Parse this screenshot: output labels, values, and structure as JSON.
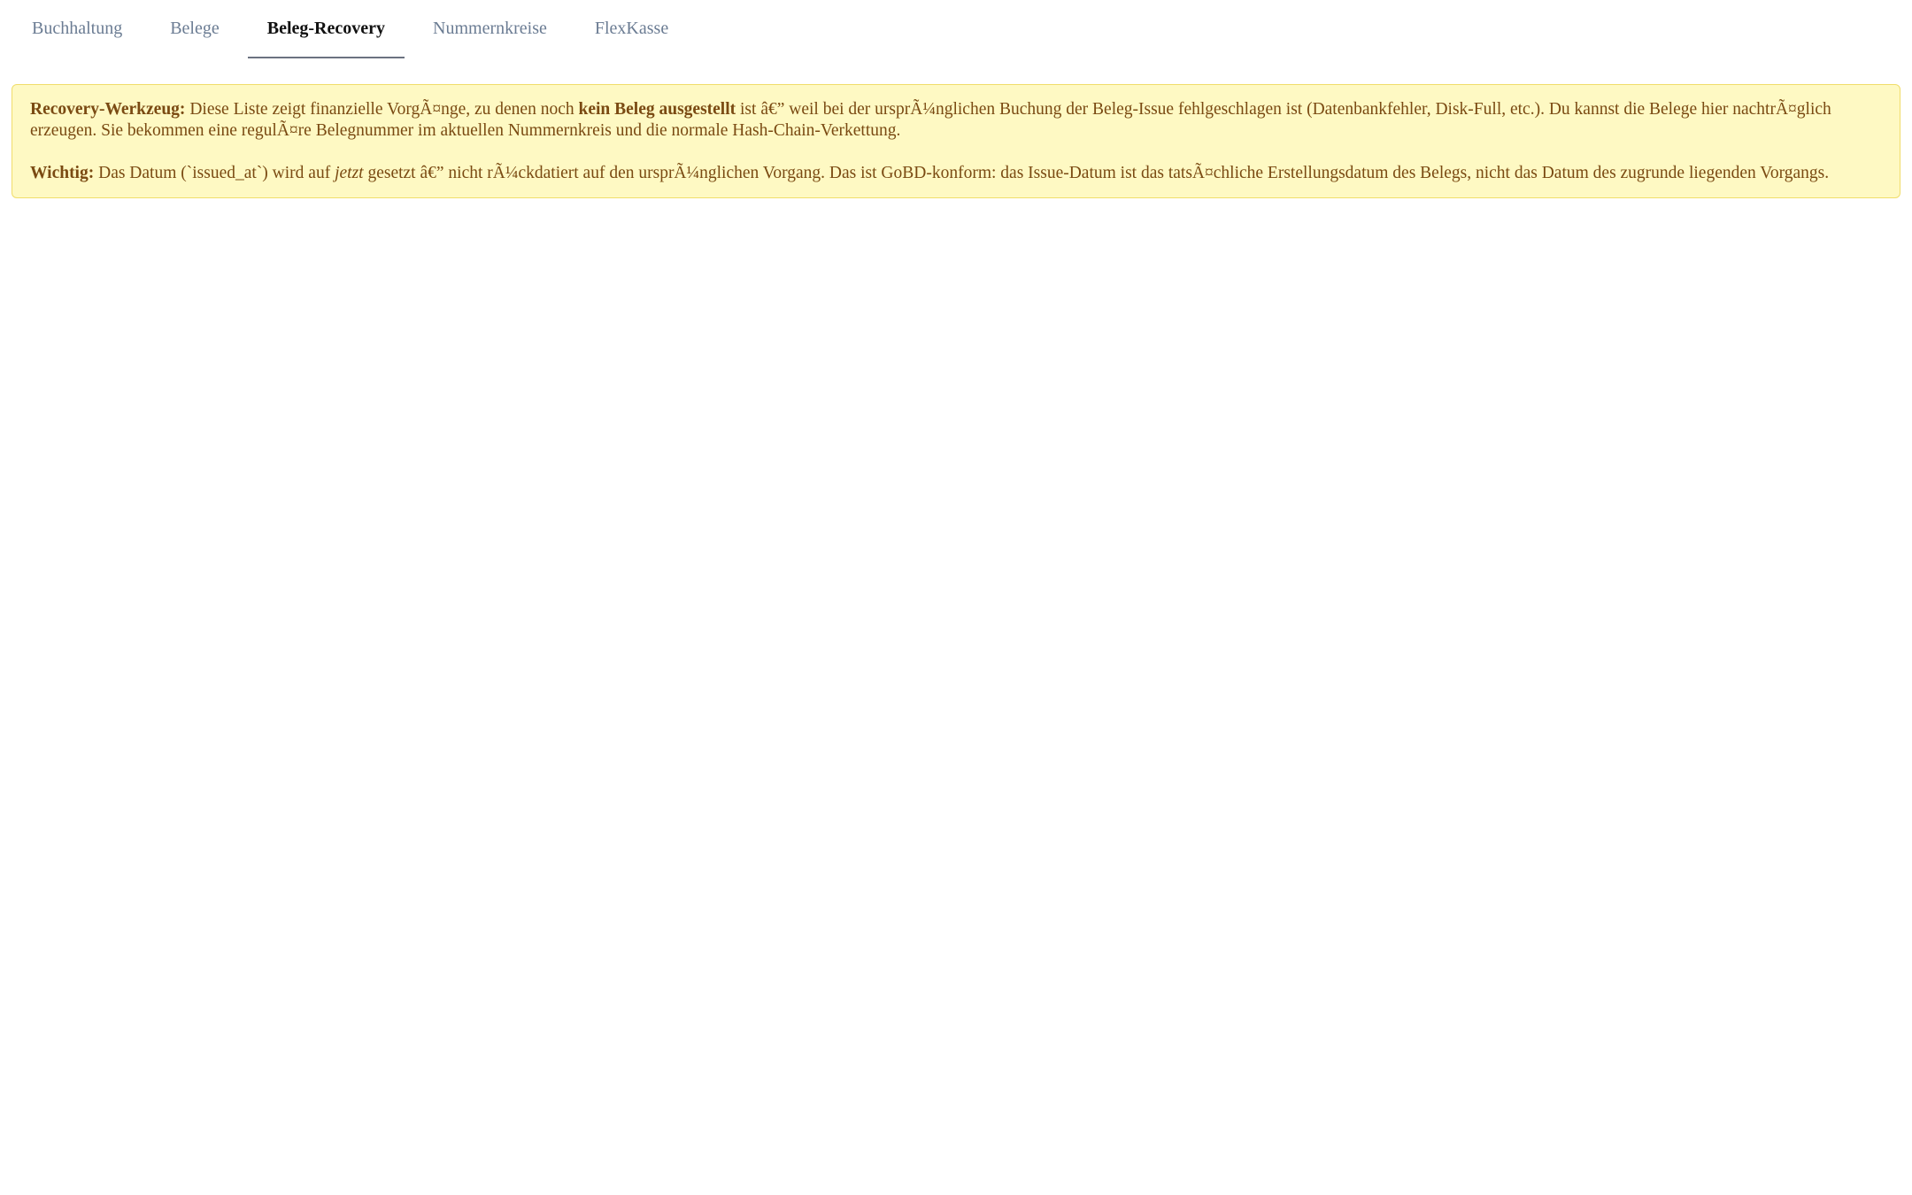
{
  "tabs": [
    {
      "label": "Buchhaltung",
      "active": false
    },
    {
      "label": "Belege",
      "active": false
    },
    {
      "label": "Beleg-Recovery",
      "active": true
    },
    {
      "label": "Nummernkreise",
      "active": false
    },
    {
      "label": "FlexKasse",
      "active": false
    }
  ],
  "notice": {
    "p1": {
      "label": "Recovery-Werkzeug:",
      "text_before": " Diese Liste zeigt finanzielle VorgÃ¤nge, zu denen noch ",
      "emphasis": "kein Beleg ausgestellt",
      "text_after": " ist â€” weil bei der ursprÃ¼nglichen Buchung der Beleg-Issue fehlgeschlagen ist (Datenbankfehler, Disk-Full, etc.). Du kannst die Belege hier nachtrÃ¤glich erzeugen. Sie bekommen eine regulÃ¤re Belegnummer im aktuellen Nummernkreis und die normale Hash-Chain-Verkettung."
    },
    "p2": {
      "label": "Wichtig:",
      "text_before": " Das Datum (`issued_at`) wird auf ",
      "emphasis": "jetzt",
      "text_after": " gesetzt â€” nicht rÃ¼ckdatiert auf den ursprÃ¼nglichen Vorgang. Das ist GoBD-konform: das Issue-Datum ist das tatsÃ¤chliche Erstellungsdatum des Belegs, nicht das Datum des zugrunde liegenden Vorgangs."
    }
  },
  "colors": {
    "notice_background": "#fef9c3",
    "notice_border": "#f0dd6a",
    "notice_text": "#7a4a12",
    "tab_inactive": "#6b7c93",
    "tab_active": "#111111"
  }
}
